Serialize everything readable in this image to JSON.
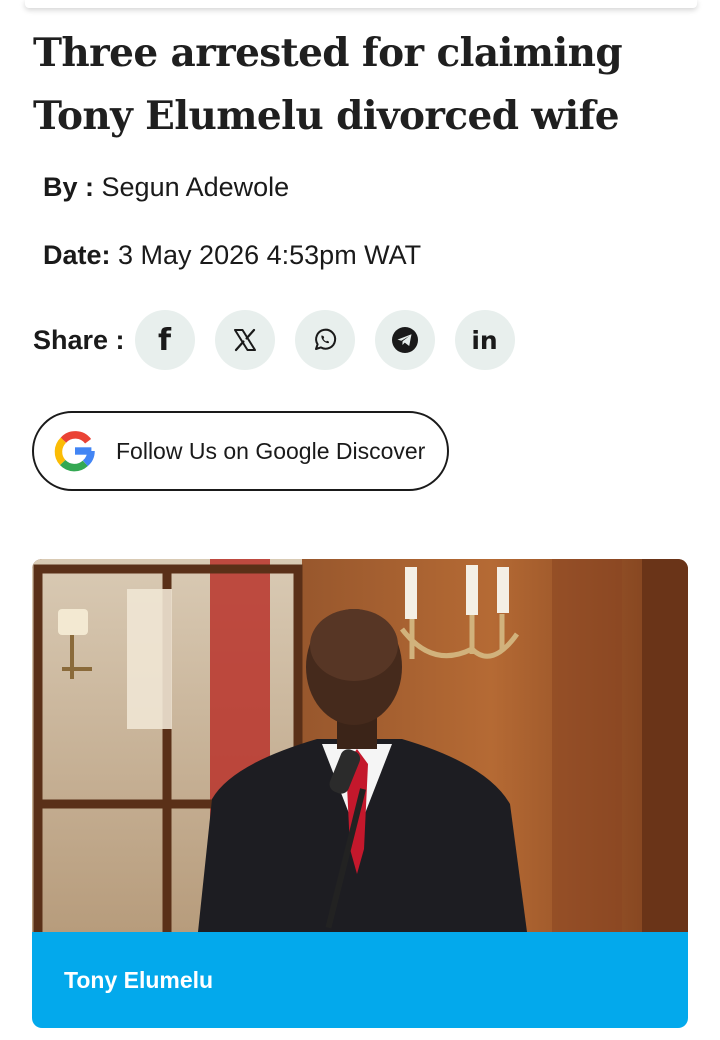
{
  "article": {
    "title": "Three arrested for claiming Tony Elumelu divorced wife",
    "byline_label": "By :",
    "author": "Segun Adewole",
    "date_label": "Date:",
    "date": "3 May 2026 4:53pm WAT"
  },
  "share": {
    "label": "Share :",
    "buttons": [
      {
        "icon": "facebook-icon",
        "label": "f"
      },
      {
        "icon": "x-icon"
      },
      {
        "icon": "whatsapp-icon"
      },
      {
        "icon": "telegram-icon"
      },
      {
        "icon": "linkedin-icon",
        "label": "in"
      }
    ]
  },
  "follow": {
    "label": "Follow Us on Google Discover",
    "icon": "google-icon"
  },
  "figure": {
    "caption": "Tony Elumelu",
    "caption_color": "#03a9ec"
  }
}
